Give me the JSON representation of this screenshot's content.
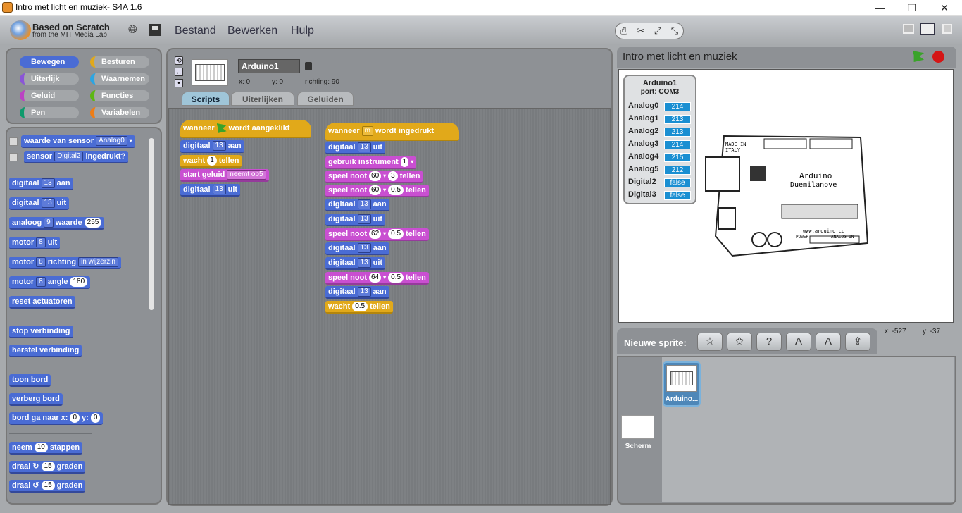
{
  "window": {
    "title": "Intro met licht en muziek- S4A 1.6",
    "minimize": "—",
    "restore": "❐",
    "close": "✕"
  },
  "logo": {
    "line1": "Based on Scratch",
    "line2": "from the MIT Media Lab"
  },
  "menu": {
    "file": "Bestand",
    "edit": "Bewerken",
    "help": "Hulp"
  },
  "categories": [
    {
      "label": "Bewegen",
      "color": "#4a6cd4"
    },
    {
      "label": "Besturen",
      "color": "#e1a91a"
    },
    {
      "label": "Uiterlijk",
      "color": "#8a55d7"
    },
    {
      "label": "Waarnemen",
      "color": "#2ca5e2"
    },
    {
      "label": "Geluid",
      "color": "#bb42c3"
    },
    {
      "label": "Functies",
      "color": "#5cb712"
    },
    {
      "label": "Pen",
      "color": "#0e9a6c"
    },
    {
      "label": "Variabelen",
      "color": "#ee7d16"
    }
  ],
  "palette": {
    "sensor_value": {
      "label": "waarde van sensor",
      "dd": "Analog0"
    },
    "sensor_pressed": {
      "label": "sensor",
      "dd": "Digital2",
      "suffix": "ingedrukt?"
    },
    "dig_on": {
      "label": "digitaal",
      "dd": "13",
      "suffix": "aan"
    },
    "dig_off": {
      "label": "digitaal",
      "dd": "13",
      "suffix": "uit"
    },
    "analog": {
      "label": "analoog",
      "dd": "9",
      "mid": "waarde",
      "val": "255"
    },
    "motor_off": {
      "label": "motor",
      "dd": "8",
      "suffix": "uit"
    },
    "motor_dir": {
      "label": "motor",
      "dd": "8",
      "mid": "richting",
      "dd2": "in wijzerzin"
    },
    "motor_angle": {
      "label": "motor",
      "dd": "8",
      "mid": "angle",
      "val": "180"
    },
    "reset": "reset actuatoren",
    "stop": "stop verbinding",
    "restore": "herstel verbinding",
    "show": "toon bord",
    "hide": "verberg bord",
    "goto": {
      "label": "bord ga naar x:",
      "x": "0",
      "ylabel": "y:",
      "y": "0"
    },
    "move": {
      "label": "neem",
      "val": "10",
      "suffix": "stappen"
    },
    "turn_cw": {
      "label": "draai",
      "icon": "↻",
      "val": "15",
      "suffix": "graden"
    },
    "turn_ccw": {
      "label": "draai",
      "icon": "↺",
      "val": "15",
      "suffix": "graden"
    }
  },
  "sprite": {
    "name": "Arduino1",
    "x": "x: 0",
    "y": "y: 0",
    "direction": "richting: 90"
  },
  "tabs": {
    "scripts": "Scripts",
    "costumes": "Uiterlijken",
    "sounds": "Geluiden"
  },
  "script1": {
    "hat": {
      "pre": "wanneer",
      "post": "wordt aangeklikt"
    },
    "b1": {
      "label": "digitaal",
      "dd": "13",
      "suffix": "aan"
    },
    "b2": {
      "label": "wacht",
      "val": "1",
      "suffix": "tellen"
    },
    "b3": {
      "label": "start geluid",
      "dd": "neemt op5"
    },
    "b4": {
      "label": "digitaal",
      "dd": "13",
      "suffix": "uit"
    }
  },
  "script2": {
    "hat": {
      "pre": "wanneer",
      "key": "m",
      "post": "wordt ingedrukt"
    },
    "lines": [
      {
        "label": "digitaal",
        "dd": "13",
        "suffix": "uit"
      },
      {
        "label": "gebruik instrument",
        "val": "1"
      },
      {
        "label": "speel noot",
        "val": "60",
        "beats": "3",
        "suffix": "tellen"
      },
      {
        "label": "speel noot",
        "val": "60",
        "beats": "0.5",
        "suffix": "tellen"
      },
      {
        "label": "digitaal",
        "dd": "13",
        "suffix": "aan"
      },
      {
        "label": "digitaal",
        "dd": "13",
        "suffix": "uit"
      },
      {
        "label": "speel noot",
        "val": "62",
        "beats": "0.5",
        "suffix": "tellen"
      },
      {
        "label": "digitaal",
        "dd": "13",
        "suffix": "aan"
      },
      {
        "label": "digitaal",
        "dd": "13",
        "suffix": "uit"
      },
      {
        "label": "speel noot",
        "val": "64",
        "beats": "0.5",
        "suffix": "tellen"
      },
      {
        "label": "digitaal",
        "dd": "13",
        "suffix": "aan"
      },
      {
        "label": "wacht",
        "val": "0.5",
        "suffix": "tellen"
      }
    ]
  },
  "stage": {
    "title": "Intro met licht en muziek",
    "coords_x": "x: -527",
    "coords_y": "y: -37"
  },
  "sensorboard": {
    "title": "Arduino1",
    "port": "port: COM3",
    "rows": [
      {
        "name": "Analog0",
        "value": "214"
      },
      {
        "name": "Analog1",
        "value": "213"
      },
      {
        "name": "Analog2",
        "value": "213"
      },
      {
        "name": "Analog3",
        "value": "214"
      },
      {
        "name": "Analog4",
        "value": "215"
      },
      {
        "name": "Analog5",
        "value": "212"
      },
      {
        "name": "Digital2",
        "value": "false"
      },
      {
        "name": "Digital3",
        "value": "false"
      }
    ]
  },
  "board_text": {
    "made": "MADE IN",
    "italy": "ITALY",
    "name": "Arduino",
    "model": "Duemilanove",
    "url": "www.arduino.cc",
    "power": "POWER",
    "analog": "ANALOG IN"
  },
  "new_sprite_label": "Nieuwe sprite:",
  "new_sprite_icons": [
    "paint-new-sprite-icon",
    "choose-sprite-file-icon",
    "random-sprite-icon",
    "board-sprite-icon",
    "edit-board-icon",
    "import-board-icon"
  ],
  "corral": {
    "sprite_label": "Arduino...",
    "stage_label": "Scherm"
  }
}
